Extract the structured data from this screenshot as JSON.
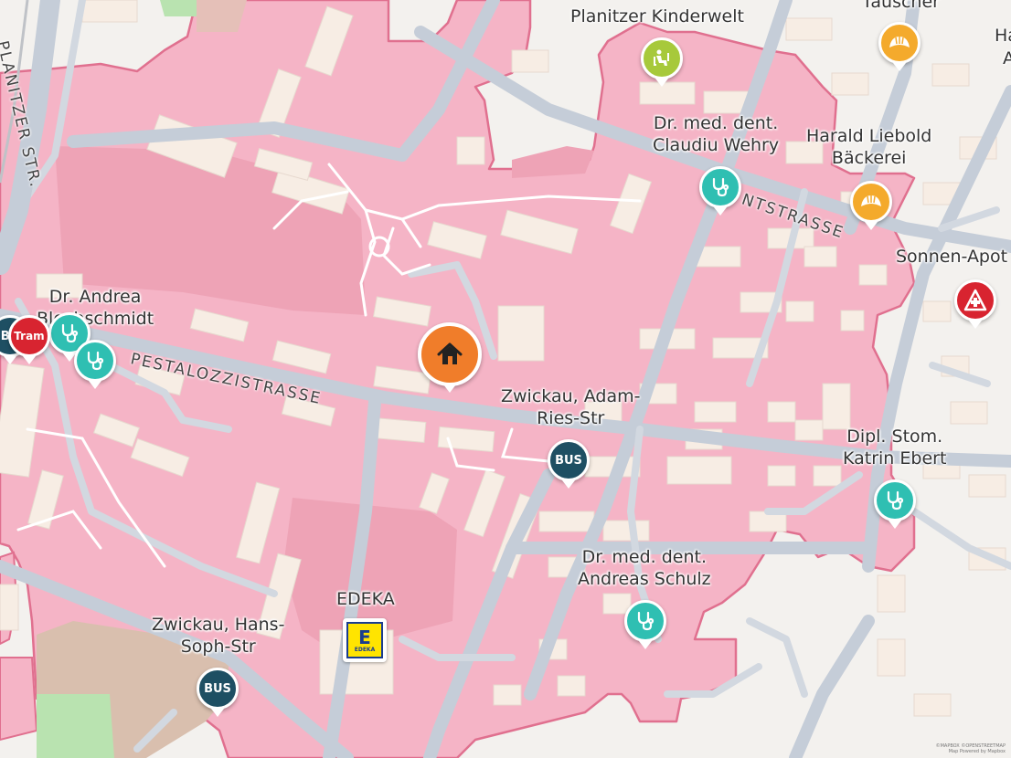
{
  "map": {
    "colors": {
      "zone_fill": "#f5b4c6",
      "zone_border": "#e0708f",
      "road": "#c5cdd8",
      "building": "#f7ede4",
      "background": "#f3f1ee"
    },
    "labels": {
      "planitzer_kinderwelt": "Planitzer Kinderwelt",
      "tauscher": "Täuscher",
      "ha_cut": "Ha",
      "a_cut": "A",
      "wehry_line1": "Dr. med. dent.",
      "wehry_line2": "Claudiu Wehry",
      "liebold_line1": "Harald Liebold",
      "liebold_line2": "Bäckerei",
      "sonnen_apotheke": "Sonnen-Apot",
      "blechschmidt_line1": "Dr. Andrea",
      "blechschmidt_line2": "Blechschmidt",
      "adam_ries_line1": "Zwickau, Adam-",
      "adam_ries_line2": "Ries-Str",
      "ebert_line1": "Dipl. Stom.",
      "ebert_line2": "Katrin Ebert",
      "schulz_line1": "Dr. med. dent.",
      "schulz_line2": "Andreas Schulz",
      "edeka": "EDEKA",
      "hans_soph_line1": "Zwickau, Hans-",
      "hans_soph_line2": "Soph-Str"
    },
    "streets": {
      "pestalozzistrasse": "PESTALOZZISTRASSE",
      "planitzer_str": "PLANITZER STR.",
      "ntstrasse": "NTSTRASSE"
    },
    "badges": {
      "bus": "BUS",
      "tram": "Tram",
      "bu_cut": "BU",
      "edeka_logo": "E",
      "edeka_small": "EDEKA"
    },
    "icons": {
      "home": "home-icon",
      "doctor": "stethoscope-icon",
      "kindergarten": "kindergarten-icon",
      "bakery": "croissant-icon",
      "pharmacy": "pharmacy-icon",
      "bus": "bus-stop-icon",
      "tram": "tram-stop-icon",
      "supermarket": "edeka-logo-icon"
    },
    "pin_colors": {
      "home": "#f07d2a",
      "doctor": "#2fbfb2",
      "kindergarten": "#a7c93b",
      "bakery": "#f4aa2c",
      "pharmacy": "#d82430",
      "bus": "#1e4f63",
      "tram": "#d82430",
      "edeka": "#ffe400"
    },
    "copyright_line1": "©MAPBOX ©OPENSTREETMAP",
    "copyright_line2": "Map Powered by Mapbox"
  }
}
